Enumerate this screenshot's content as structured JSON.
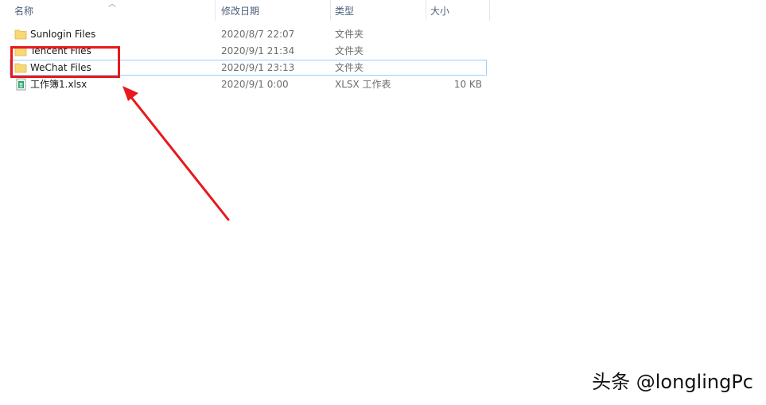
{
  "columns": {
    "name": "名称",
    "modified": "修改日期",
    "type": "类型",
    "size": "大小"
  },
  "files": [
    {
      "name": "Sunlogin Files",
      "modified": "2020/8/7 22:07",
      "type": "文件夹",
      "size": "",
      "icon": "folder-icon"
    },
    {
      "name": "Tencent Files",
      "modified": "2020/9/1 21:34",
      "type": "文件夹",
      "size": "",
      "icon": "folder-icon"
    },
    {
      "name": "WeChat Files",
      "modified": "2020/9/1 23:13",
      "type": "文件夹",
      "size": "",
      "icon": "folder-icon",
      "selected": true
    },
    {
      "name": "工作簿1.xlsx",
      "modified": "2020/9/1 0:00",
      "type": "XLSX 工作表",
      "size": "10 KB",
      "icon": "xlsx-file-icon"
    }
  ],
  "annotation": {
    "highlight_color": "#e8191d"
  },
  "watermark": "头条 @longlingPc",
  "colors": {
    "folder": "#f8d775",
    "selection_border": "#99d1ff",
    "header_text": "#4c607a"
  }
}
